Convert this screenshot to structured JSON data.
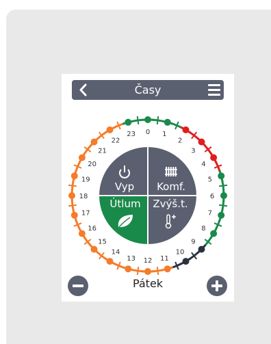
{
  "header": {
    "title": "Časy",
    "back_icon": "chevron-left-icon",
    "menu_icon": "hamburger-menu-icon"
  },
  "modes": {
    "off": {
      "label": "Vyp",
      "icon": "power-icon",
      "color": "#5a6070"
    },
    "comfort": {
      "label": "Komf.",
      "icon": "radiator-icon",
      "color": "#5a6070"
    },
    "setback": {
      "label": "Útlum",
      "icon": "leaf-icon",
      "color": "#1a8a4a"
    },
    "boost": {
      "label": "Zvýš.t.",
      "icon": "thermometer-plus-icon",
      "color": "#5a6070"
    }
  },
  "hours": [
    "0",
    "1",
    "2",
    "3",
    "4",
    "5",
    "6",
    "7",
    "8",
    "9",
    "10",
    "11",
    "12",
    "13",
    "14",
    "15",
    "16",
    "17",
    "18",
    "19",
    "20",
    "21",
    "22",
    "23"
  ],
  "ring_colors": {
    "green": "#1a8a4a",
    "red": "#e01e1e",
    "orange": "#f47c2a",
    "dark": "#2a3040"
  },
  "schedule": [
    "green",
    "green",
    "green",
    "green",
    "red",
    "red",
    "red",
    "red",
    "red",
    "red",
    "green",
    "green",
    "green",
    "green",
    "green",
    "green",
    "green",
    "green",
    "dark",
    "dark",
    "dark",
    "dark",
    "orange",
    "orange",
    "orange",
    "orange",
    "orange",
    "orange",
    "orange",
    "orange",
    "orange",
    "orange",
    "orange",
    "orange",
    "orange",
    "orange",
    "orange",
    "orange",
    "orange",
    "orange",
    "orange",
    "orange",
    "orange",
    "orange",
    "orange",
    "orange",
    "green",
    "green"
  ],
  "footer": {
    "day": "Pátek",
    "minus_icon": "minus-icon",
    "plus_icon": "plus-icon"
  }
}
